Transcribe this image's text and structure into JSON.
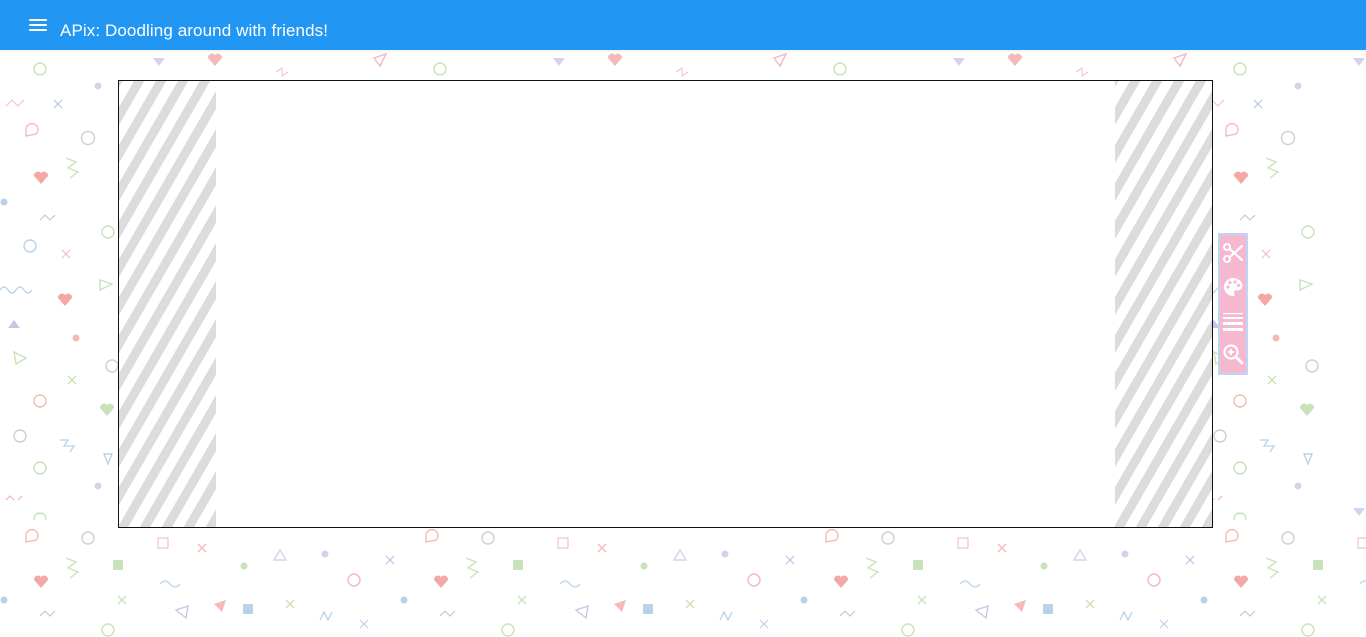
{
  "app": {
    "title": "APix: Doodling around with friends!"
  },
  "appbar": {
    "color": "#2196f3",
    "menu_icon": "hamburger-menu-icon"
  },
  "canvas": {
    "border_color": "#111111",
    "margin_pattern": "diagonal-stripes"
  },
  "toolbar": {
    "background": "#f6b8cf",
    "tools": [
      {
        "icon": "scissors-icon",
        "name": "cut"
      },
      {
        "icon": "palette-icon",
        "name": "colors"
      },
      {
        "icon": "line-width-icon",
        "name": "brush-size"
      },
      {
        "icon": "zoom-in-icon",
        "name": "zoom"
      }
    ]
  },
  "background": {
    "pattern": "pastel-doodle-shapes"
  }
}
